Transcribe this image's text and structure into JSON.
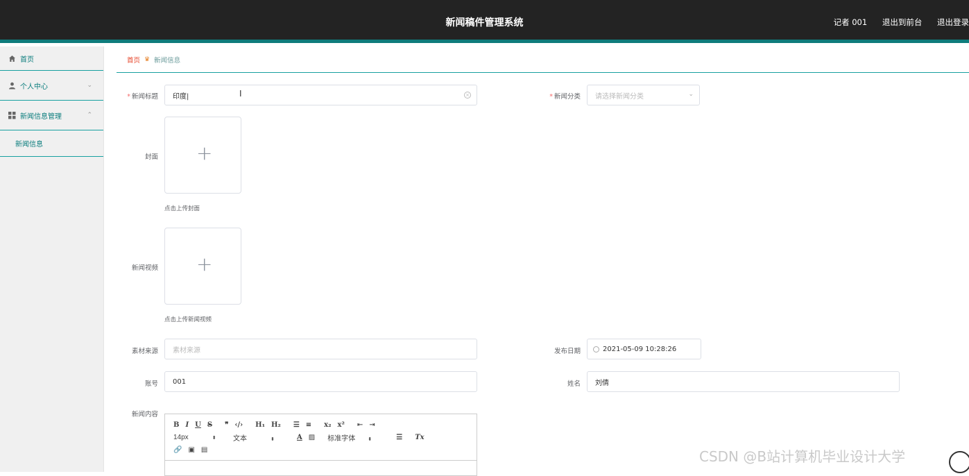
{
  "header": {
    "title": "新闻稿件管理系统",
    "user": "记者 001",
    "to_front": "退出到前台",
    "logout": "退出登录"
  },
  "sidebar": {
    "items": [
      {
        "label": "首页",
        "icon": "home-icon"
      },
      {
        "label": "个人中心",
        "icon": "user-icon",
        "chevron": "⌄"
      },
      {
        "label": "新闻信息管理",
        "icon": "grid-icon",
        "chevron": "⌃"
      }
    ],
    "sub_items": [
      {
        "label": "新闻信息"
      }
    ]
  },
  "breadcrumb": {
    "home": "首页",
    "separator": "♛",
    "current": "新闻信息"
  },
  "form": {
    "title_label": "新闻标题",
    "title_value": "印度|",
    "category_label": "新闻分类",
    "category_placeholder": "请选择新闻分类",
    "cover_label": "封面",
    "cover_hint": "点击上传封面",
    "video_label": "新闻视频",
    "video_hint": "点击上传新闻视频",
    "source_label": "素材来源",
    "source_placeholder": "素材来源",
    "date_label": "发布日期",
    "date_value": "2021-05-09 10:28:26",
    "account_label": "账号",
    "account_value": "001",
    "name_label": "姓名",
    "name_value": "刘倩",
    "content_label": "新闻内容"
  },
  "editor": {
    "font_size": "14px",
    "text_type": "文本",
    "font_family": "标准字体"
  },
  "watermark": "CSDN @B站计算机毕业设计大学"
}
